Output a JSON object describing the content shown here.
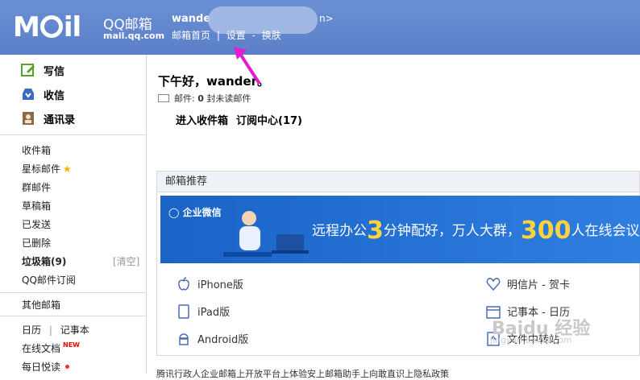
{
  "header": {
    "logo_text_1": "M",
    "logo_text_2": "il",
    "brand_name": "QQ邮箱",
    "brand_url": "mail.qq.com",
    "user_name": "wande",
    "user_suffix": "n>",
    "nav": [
      "邮箱首页",
      "设置",
      "换肤"
    ],
    "nav_sep_1": "|",
    "nav_sep_2": "-"
  },
  "sidebar": {
    "primary": [
      {
        "label": "写信",
        "icon": "compose-icon"
      },
      {
        "label": "收信",
        "icon": "inbox-icon"
      },
      {
        "label": "通讯录",
        "icon": "contacts-icon"
      }
    ],
    "folders": [
      {
        "label": "收件箱"
      },
      {
        "label": "星标邮件",
        "star": "★"
      },
      {
        "label": "群邮件"
      },
      {
        "label": "草稿箱"
      },
      {
        "label": "已发送"
      },
      {
        "label": "已删除"
      },
      {
        "label": "垃圾箱(9)",
        "action": "[清空]"
      },
      {
        "label": "QQ邮件订阅"
      }
    ],
    "other_mailbox": "其他邮箱",
    "tools": {
      "calendar": "日历",
      "sep": "|",
      "notes": "记事本",
      "online_docs": "在线文档",
      "new_badge": "NEW",
      "daily": "每日悦读"
    }
  },
  "main": {
    "greeting": "下午好，wander。",
    "mail_label": "邮件:",
    "mail_count": "0",
    "mail_suffix": "封未读邮件",
    "link_inbox": "进入收件箱",
    "link_subscribe": "订阅中心(17)",
    "panel_title": "邮箱推荐",
    "banner": {
      "logo": "企业微信",
      "text_a": "远程办公",
      "num_a": "3",
      "text_b": "分钟配好，万人大群，",
      "num_b": "300",
      "text_c": "人在线会议"
    },
    "features": [
      {
        "label": "iPhone版",
        "icon": "apple-icon"
      },
      {
        "label": "明信片 - 贺卡",
        "icon": "heart-icon"
      },
      {
        "label": "iPad版",
        "icon": "tablet-icon"
      },
      {
        "label": "记事本 - 日历",
        "icon": "calendar-icon"
      },
      {
        "label": "Android版",
        "icon": "android-icon"
      },
      {
        "label": "文件中转站",
        "icon": "file-transfer-icon"
      }
    ],
    "footer": "腾讯行政人企业邮箱上开放平台上体验安上邮箱助手上向敢直识上隐私政策"
  },
  "watermark": {
    "main": "Baidu 经验",
    "sub": "jingyan.baidu.com"
  },
  "colors": {
    "header": "#5b80c8",
    "banner": "#1a63c7",
    "highlight": "#ffd23f",
    "arrow": "#e020d0"
  }
}
